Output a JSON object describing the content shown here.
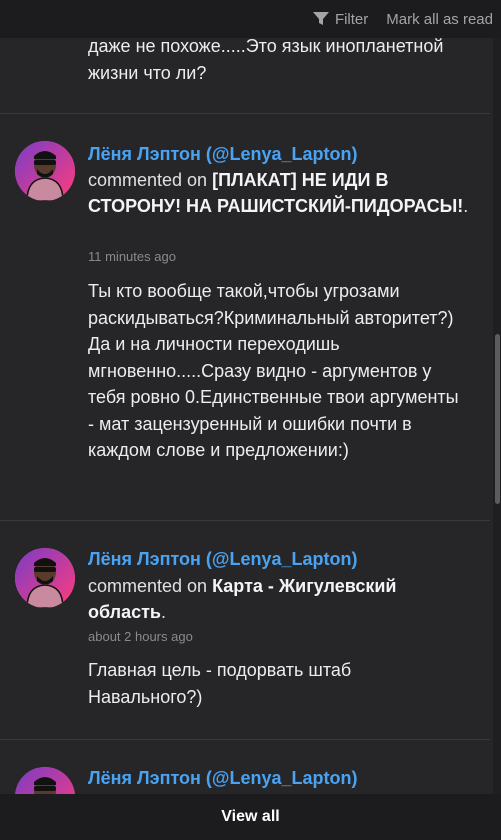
{
  "header": {
    "filter_label": "Filter",
    "mark_all_label": "Mark all as read"
  },
  "partial_text": "даже не похоже.....Это язык инопланетной жизни что ли?",
  "notifications": [
    {
      "author": "Лёня Лэптон (@Lenya_Lapton)",
      "action": "commented on",
      "post_title": "[ПЛАКАТ] НЕ ИДИ В СТОРОНУ! НА РАШИСТСКИЙ-ПИДОРАСЫ!",
      "punct": ".",
      "time": "11 minutes ago",
      "body": "Ты кто вообще такой,чтобы угрозами раскидываться?Криминальный авторитет?)\nДа и на личности переходишь мгновенно.....Сразу видно - аргументов у тебя ровно 0.Единственные твои аргументы - мат зацензуренный и ошибки почти в каждом слове и предложении:)"
    },
    {
      "author": "Лёня Лэптон (@Lenya_Lapton)",
      "action": "commented on",
      "post_title": "Карта - Жигулевский область",
      "punct": ".",
      "time": "about 2 hours ago",
      "body": "Главная цель - подорвать штаб Навального?)"
    },
    {
      "author": "Лёня Лэптон (@Lenya_Lapton)"
    }
  ],
  "footer": {
    "view_all_label": "View all"
  }
}
